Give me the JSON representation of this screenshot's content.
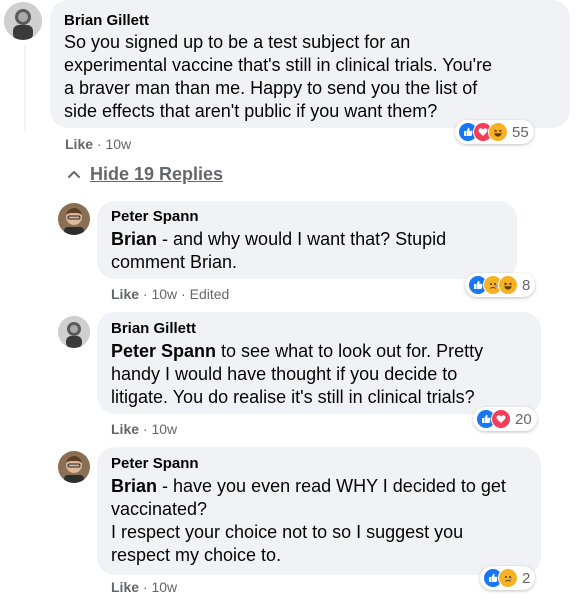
{
  "thread": {
    "hide_replies_label": "Hide 19 Replies"
  },
  "comments": [
    {
      "author": "Brian Gillett",
      "lines": [
        "So you signed up to be a test subject for an",
        "experimental vaccine that's still in clinical trials. You're",
        "a braver man than me. Happy to send you the list of",
        "side effects that aren't public if you want them?"
      ],
      "like_label": "Like",
      "sep": "·",
      "time": "10w",
      "edited": "",
      "reaction_icons": [
        "like-icon",
        "love-icon",
        "haha-icon"
      ],
      "reaction_count": "55"
    },
    {
      "author": "Peter Spann",
      "mention": "Brian",
      "lines": [
        " - and why would I want that? Stupid",
        "comment Brian."
      ],
      "like_label": "Like",
      "sep": "·",
      "time": "10w",
      "edited": "Edited",
      "reaction_icons": [
        "like-icon",
        "sad-icon",
        "haha-icon"
      ],
      "reaction_count": "8"
    },
    {
      "author": "Brian Gillett",
      "mention": "Peter Spann",
      "lines": [
        " to see what to look out for. Pretty",
        "handy I would have thought if you decide to",
        "litigate. You do realise it's still in clinical trials?"
      ],
      "like_label": "Like",
      "sep": "·",
      "time": "10w",
      "edited": "",
      "reaction_icons": [
        "like-icon",
        "love-icon"
      ],
      "reaction_count": "20"
    },
    {
      "author": "Peter Spann",
      "mention": "Brian",
      "lines": [
        " - have you even read WHY I decided to get",
        "vaccinated?",
        "I respect your choice not to so I suggest you",
        "respect my choice to."
      ],
      "like_label": "Like",
      "sep": "·",
      "time": "10w",
      "edited": "",
      "reaction_icons": [
        "like-icon",
        "sad-icon"
      ],
      "reaction_count": "2"
    }
  ],
  "colors": {
    "bubble": "#f0f2f5",
    "meta_text": "#65676b",
    "like_blue": "#1877f2",
    "love_red": "#f33e58",
    "emoji_yellow": "#f7b125"
  }
}
